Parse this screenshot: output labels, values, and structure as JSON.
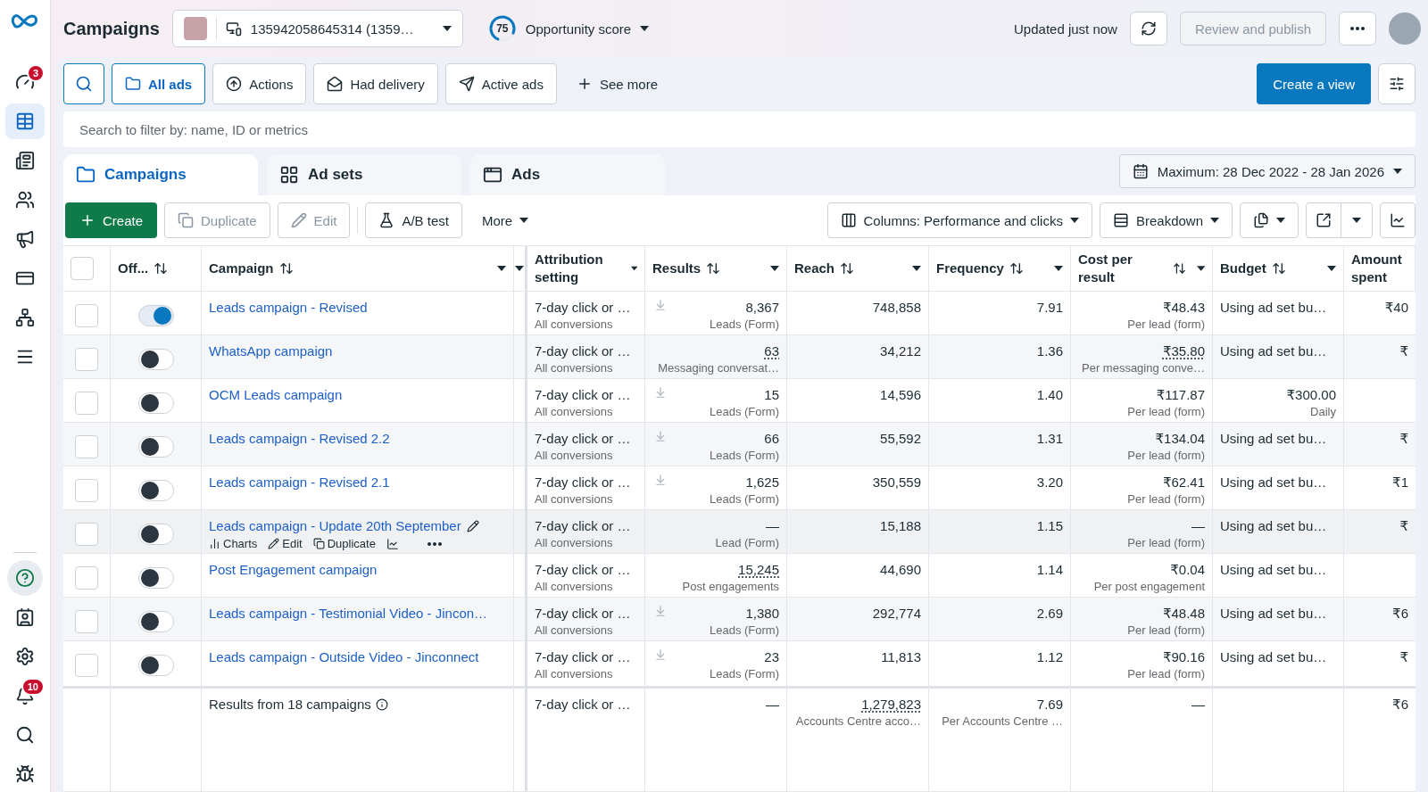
{
  "sidebar": {
    "top": [
      {
        "badge": "3",
        "selected": false
      },
      {
        "selected": true
      },
      {
        "selected": false
      },
      {
        "selected": false
      },
      {
        "selected": false
      },
      {
        "selected": false
      },
      {
        "selected": false
      },
      {
        "selected": false
      }
    ],
    "bottom": [
      {
        "selected": true
      },
      {
        "selected": false
      },
      {
        "selected": false
      },
      {
        "badge": "10",
        "selected": false
      },
      {
        "selected": false
      },
      {
        "selected": false
      }
    ]
  },
  "topbar": {
    "title": "Campaigns",
    "account": "135942058645314 (1359…",
    "score": {
      "value": "75",
      "level": 0.75,
      "label": "Opportunity score"
    },
    "updated": "Updated just now",
    "publish": {
      "label": "Review and publish",
      "disabled": true
    }
  },
  "filters": {
    "chips": [
      {
        "label": "All ads",
        "selected": true
      },
      {
        "label": "Actions",
        "selected": false
      },
      {
        "label": "Had delivery",
        "selected": false
      },
      {
        "label": "Active ads",
        "selected": false
      }
    ],
    "see_more": "See more",
    "create_view": "Create a view",
    "search": {
      "placeholder": "Search to filter by: name, ID or metrics"
    }
  },
  "levels": [
    {
      "label": "Campaigns",
      "selected": true
    },
    {
      "label": "Ad sets",
      "selected": false
    },
    {
      "label": "Ads",
      "selected": false
    }
  ],
  "date_range": "Maximum: 28 Dec 2022 - 28 Jan 2026",
  "toolbar": {
    "create": "Create",
    "actions": [
      {
        "label": "Duplicate",
        "disabled": true
      },
      {
        "label": "Edit",
        "disabled": true
      },
      {
        "label": "A/B test",
        "disabled": false
      }
    ],
    "more": "More",
    "columns": "Columns: Performance and clicks",
    "breakdown": "Breakdown"
  },
  "select_all": {
    "checked": false
  },
  "columns": [
    {
      "label": "Off...",
      "sortable": true,
      "menu": false
    },
    {
      "label": "Campaign",
      "sortable": true,
      "menu": true
    },
    {
      "label": "Attribution setting",
      "sortable": false,
      "menu": true
    },
    {
      "label": "Results",
      "sortable": true,
      "menu": true
    },
    {
      "label": "Reach",
      "sortable": true,
      "menu": true
    },
    {
      "label": "Frequency",
      "sortable": true,
      "menu": true
    },
    {
      "label": "Cost per result",
      "sortable": true,
      "menu": true
    },
    {
      "label": "Budget",
      "sortable": true,
      "menu": true
    },
    {
      "label": "Amount spent",
      "sortable": false,
      "menu": false
    }
  ],
  "rows": [
    {
      "checked": false,
      "on": true,
      "hovered": false,
      "name": "Leads campaign - Revised",
      "attribution": "7-day click or …",
      "attribution_sub": "All conversions",
      "results": "8,367",
      "results_sub": "Leads (Form)",
      "download": true,
      "results_dotted": false,
      "reach": "748,858",
      "frequency": "7.91",
      "cost": "₹48.43",
      "cost_sub": "Per lead (form)",
      "cost_dotted": false,
      "budget": "Using ad set bu…",
      "amount": "₹40"
    },
    {
      "checked": false,
      "on": false,
      "hovered": false,
      "name": "WhatsApp campaign",
      "attribution": "7-day click or …",
      "attribution_sub": "All conversions",
      "results": "63",
      "results_sub": "Messaging conversat…",
      "download": false,
      "results_dotted": true,
      "reach": "34,212",
      "frequency": "1.36",
      "cost": "₹35.80",
      "cost_sub": "Per messaging conve…",
      "cost_dotted": true,
      "budget": "Using ad set bu…",
      "amount": "₹"
    },
    {
      "checked": false,
      "on": false,
      "hovered": false,
      "name": "OCM Leads campaign",
      "attribution": "7-day click or …",
      "attribution_sub": "All conversions",
      "results": "15",
      "results_sub": "Leads (Form)",
      "download": true,
      "results_dotted": false,
      "reach": "14,596",
      "frequency": "1.40",
      "cost": "₹117.87",
      "cost_sub": "Per lead (form)",
      "cost_dotted": false,
      "budget": "₹300.00",
      "budget_sub": "Daily"
    },
    {
      "checked": false,
      "on": false,
      "hovered": false,
      "name": "Leads campaign - Revised 2.2",
      "attribution": "7-day click or …",
      "attribution_sub": "All conversions",
      "results": "66",
      "results_sub": "Leads (Form)",
      "download": true,
      "results_dotted": false,
      "reach": "55,592",
      "frequency": "1.31",
      "cost": "₹134.04",
      "cost_sub": "Per lead (form)",
      "cost_dotted": false,
      "budget": "Using ad set bu…",
      "amount": "₹"
    },
    {
      "checked": false,
      "on": false,
      "hovered": false,
      "name": "Leads campaign - Revised 2.1",
      "attribution": "7-day click or …",
      "attribution_sub": "All conversions",
      "results": "1,625",
      "results_sub": "Leads (Form)",
      "download": true,
      "results_dotted": false,
      "reach": "350,559",
      "frequency": "3.20",
      "cost": "₹62.41",
      "cost_sub": "Per lead (form)",
      "cost_dotted": false,
      "budget": "Using ad set bu…",
      "amount": "₹1"
    },
    {
      "checked": false,
      "on": false,
      "hovered": true,
      "name": "Leads campaign - Update 20th September",
      "actions": [
        "Charts",
        "Edit",
        "Duplicate"
      ],
      "attribution": "7-day click or …",
      "attribution_sub": "All conversions",
      "results": "—",
      "results_sub": "Lead (Form)",
      "download": false,
      "results_dotted": false,
      "reach": "15,188",
      "frequency": "1.15",
      "cost": "—",
      "cost_sub": "Per lead (form)",
      "cost_dotted": false,
      "budget": "Using ad set bu…",
      "amount": "₹"
    },
    {
      "checked": false,
      "on": false,
      "hovered": false,
      "name": "Post Engagement campaign",
      "attribution": "7-day click or …",
      "attribution_sub": "All conversions",
      "results": "15,245",
      "results_sub": "Post engagements",
      "download": false,
      "results_dotted": true,
      "reach": "44,690",
      "frequency": "1.14",
      "cost": "₹0.04",
      "cost_sub": "Per post engagement",
      "cost_dotted": false,
      "budget": "Using ad set bu…"
    },
    {
      "checked": false,
      "on": false,
      "hovered": false,
      "name": "Leads campaign - Testimonial Video - Jincon…",
      "attribution": "7-day click or …",
      "attribution_sub": "All conversions",
      "results": "1,380",
      "results_sub": "Leads (Form)",
      "download": true,
      "results_dotted": false,
      "reach": "292,774",
      "frequency": "2.69",
      "cost": "₹48.48",
      "cost_sub": "Per lead (form)",
      "cost_dotted": false,
      "budget": "Using ad set bu…",
      "amount": "₹6"
    },
    {
      "checked": false,
      "on": false,
      "hovered": false,
      "name": "Leads campaign - Outside Video - Jinconnect",
      "attribution": "7-day click or …",
      "attribution_sub": "All conversions",
      "results": "23",
      "results_sub": "Leads (Form)",
      "download": true,
      "results_dotted": false,
      "reach": "11,813",
      "frequency": "1.12",
      "cost": "₹90.16",
      "cost_sub": "Per lead (form)",
      "cost_dotted": false,
      "budget": "Using ad set bu…",
      "amount": "₹"
    }
  ],
  "summary": {
    "label": "Results from 18 campaigns",
    "attribution": "7-day click or …",
    "results": "—",
    "reach": "1,279,823",
    "reach_sub": "Accounts Centre acco…",
    "frequency": "7.69",
    "frequency_sub": "Per Accounts Centre …",
    "cost": "—",
    "amount": "₹6"
  }
}
